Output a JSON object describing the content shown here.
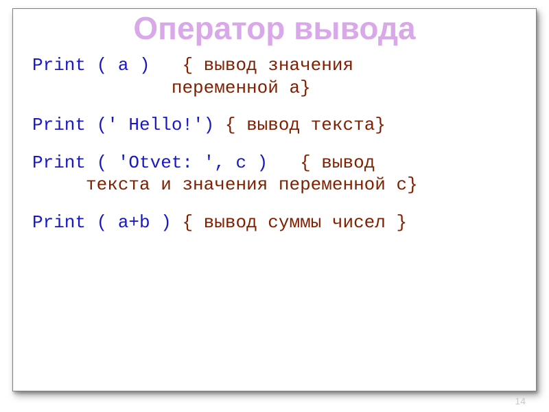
{
  "title": "Оператор вывода",
  "lines": {
    "l1a": "Print ( a )   ",
    "l1b": "{ вывод значения",
    "l1c": "             переменной а}",
    "l2a": "Print (' Hello!') ",
    "l2b": "{ вывод текста}",
    "l3a": "Print ( 'Otvet: ', c )   ",
    "l3b": "{ вывод",
    "l3c": "     текста и значения переменной с}",
    "l4a": "Print ( a+b ) ",
    "l4b": "{ вывод суммы чисел }"
  },
  "page_number": "14"
}
